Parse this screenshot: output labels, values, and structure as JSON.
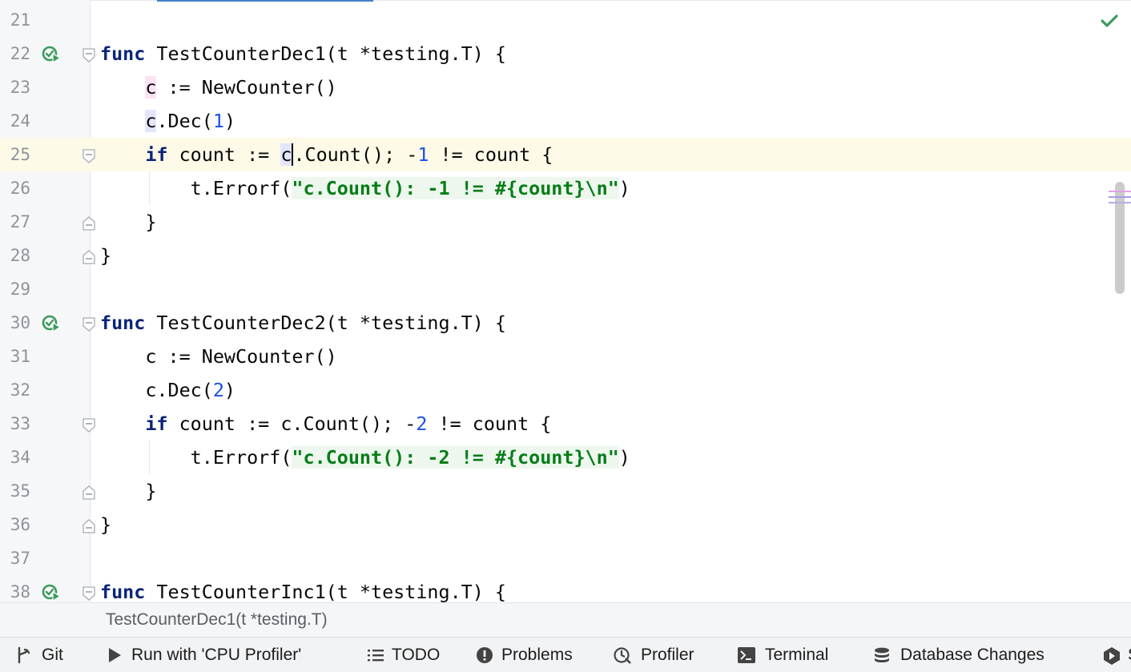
{
  "editor": {
    "lines": [
      {
        "n": "21",
        "segments": []
      },
      {
        "n": "22",
        "run": true,
        "fold": "open",
        "segments": [
          {
            "t": "func",
            "c": "kw"
          },
          {
            "t": " TestCounterDec1(t *testing.T) {"
          }
        ]
      },
      {
        "n": "23",
        "segments": [
          {
            "t": "    "
          },
          {
            "t": "c",
            "c": "hl-write"
          },
          {
            "t": " := NewCounter()"
          }
        ]
      },
      {
        "n": "24",
        "segments": [
          {
            "t": "    "
          },
          {
            "t": "c",
            "c": "hl-read"
          },
          {
            "t": ".Dec("
          },
          {
            "t": "1",
            "c": "num"
          },
          {
            "t": ")"
          }
        ]
      },
      {
        "n": "25",
        "current": true,
        "fold": "open",
        "segments": [
          {
            "t": "    "
          },
          {
            "t": "if",
            "c": "kw"
          },
          {
            "t": " count := "
          },
          {
            "t": "c",
            "c": "hl-read"
          },
          {
            "caret": true
          },
          {
            "t": ".Count(); -"
          },
          {
            "t": "1",
            "c": "num"
          },
          {
            "t": " != count {"
          }
        ]
      },
      {
        "n": "26",
        "segments": [
          {
            "t": "        t.Errorf("
          },
          {
            "t": "\"c.Count(): -1 != #{count}\\n\"",
            "c": "str"
          },
          {
            "t": ")"
          }
        ]
      },
      {
        "n": "27",
        "fold": "close",
        "segments": [
          {
            "t": "    }"
          }
        ]
      },
      {
        "n": "28",
        "fold": "close",
        "segments": [
          {
            "t": "}"
          }
        ]
      },
      {
        "n": "29",
        "segments": []
      },
      {
        "n": "30",
        "run": true,
        "fold": "open",
        "segments": [
          {
            "t": "func",
            "c": "kw"
          },
          {
            "t": " TestCounterDec2(t *testing.T) {"
          }
        ]
      },
      {
        "n": "31",
        "segments": [
          {
            "t": "    c := NewCounter()"
          }
        ]
      },
      {
        "n": "32",
        "segments": [
          {
            "t": "    c.Dec("
          },
          {
            "t": "2",
            "c": "num"
          },
          {
            "t": ")"
          }
        ]
      },
      {
        "n": "33",
        "fold": "open",
        "segments": [
          {
            "t": "    "
          },
          {
            "t": "if",
            "c": "kw"
          },
          {
            "t": " count := c.Count(); -"
          },
          {
            "t": "2",
            "c": "num"
          },
          {
            "t": " != count {"
          }
        ]
      },
      {
        "n": "34",
        "segments": [
          {
            "t": "        t.Errorf("
          },
          {
            "t": "\"c.Count(): -2 != #{count}\\n\"",
            "c": "str"
          },
          {
            "t": ")"
          }
        ]
      },
      {
        "n": "35",
        "fold": "close",
        "segments": [
          {
            "t": "    }"
          }
        ]
      },
      {
        "n": "36",
        "fold": "close",
        "segments": [
          {
            "t": "}"
          }
        ]
      },
      {
        "n": "37",
        "segments": []
      },
      {
        "n": "38",
        "run": true,
        "fold": "open",
        "segments": [
          {
            "t": "func",
            "c": "kw"
          },
          {
            "t": " TestCounterInc1(t *testing.T) {"
          }
        ]
      }
    ],
    "status_icon": "check-icon",
    "colors": {
      "keyword": "#0a2478",
      "number": "#1750eb",
      "string": "#067d17",
      "current_line": "#fdfbe8",
      "run_icon": "#3c9b5a"
    }
  },
  "breadcrumb": {
    "text": "TestCounterDec1(t *testing.T)"
  },
  "toolbar": {
    "items": [
      {
        "id": "git",
        "icon": "git-icon",
        "label": "Git"
      },
      {
        "id": "run",
        "icon": "play-icon",
        "label": "Run with 'CPU Profiler'"
      },
      {
        "id": "todo",
        "icon": "list-icon",
        "label": "TODO"
      },
      {
        "id": "problems",
        "icon": "alert-icon",
        "label": "Problems"
      },
      {
        "id": "profiler",
        "icon": "profiler-icon",
        "label": "Profiler"
      },
      {
        "id": "terminal",
        "icon": "terminal-icon",
        "label": "Terminal"
      },
      {
        "id": "db",
        "icon": "database-icon",
        "label": "Database Changes"
      },
      {
        "id": "services",
        "icon": "services-icon",
        "label": "S"
      }
    ]
  }
}
